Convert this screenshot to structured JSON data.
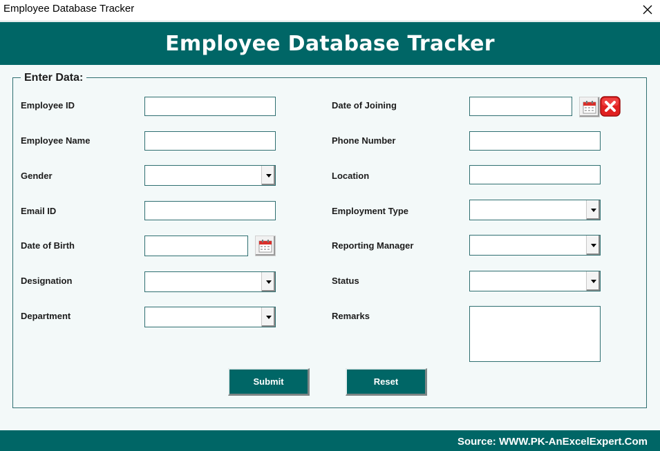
{
  "window": {
    "title": "Employee Database Tracker"
  },
  "header": {
    "title": "Employee Database Tracker"
  },
  "form": {
    "legend": "Enter Data:",
    "labels": {
      "employee_id": "Employee ID",
      "employee_name": "Employee Name",
      "gender": "Gender",
      "email_id": "Email ID",
      "date_of_birth": "Date of Birth",
      "designation": "Designation",
      "department": "Department",
      "date_of_joining": "Date of Joining",
      "phone_number": "Phone Number",
      "location": "Location",
      "employment_type": "Employment Type",
      "reporting_manager": "Reporting Manager",
      "status": "Status",
      "remarks": "Remarks"
    },
    "values": {
      "employee_id": "",
      "employee_name": "",
      "gender": "",
      "email_id": "",
      "date_of_birth": "",
      "designation": "",
      "department": "",
      "date_of_joining": "",
      "phone_number": "",
      "location": "",
      "employment_type": "",
      "reporting_manager": "",
      "status": "",
      "remarks": ""
    }
  },
  "buttons": {
    "submit": "Submit",
    "reset": "Reset"
  },
  "footer": {
    "source": "Source: WWW.PK-AnExcelExpert.Com"
  },
  "icons": {
    "close": "close-icon",
    "calendar": "calendar-icon",
    "clear_date": "clear-date-icon",
    "dropdown": "chevron-down-icon"
  },
  "colors": {
    "primary": "#006666",
    "border": "#2e6e70",
    "background": "#f3f9f9",
    "clear_red": "#e02020"
  }
}
